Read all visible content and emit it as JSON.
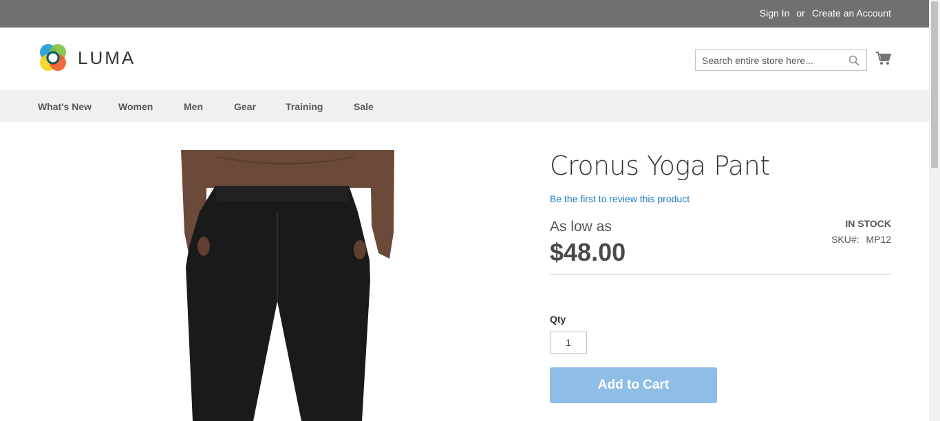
{
  "topbar": {
    "sign_in": "Sign In",
    "or": "or",
    "create_account": "Create an Account"
  },
  "header": {
    "logo_text": "LUMA",
    "search_placeholder": "Search entire store here...",
    "icons": [
      "search-icon",
      "cart-icon"
    ]
  },
  "nav": {
    "items": [
      {
        "label": "What's New"
      },
      {
        "label": "Women"
      },
      {
        "label": "Men"
      },
      {
        "label": "Gear"
      },
      {
        "label": "Training"
      },
      {
        "label": "Sale"
      }
    ]
  },
  "product": {
    "title": "Cronus Yoga Pant",
    "review_link": "Be the first to review this product",
    "price_label": "As low as",
    "price": "$48.00",
    "stock": "IN STOCK",
    "sku_label": "SKU#:",
    "sku": "MP12",
    "qty_label": "Qty",
    "qty_value": "1",
    "add_to_cart": "Add to Cart"
  },
  "colors": {
    "topbar": "#6e716e",
    "nav_bg": "#f0f0f0",
    "link": "#1979c3",
    "button": "#8ebde5"
  }
}
